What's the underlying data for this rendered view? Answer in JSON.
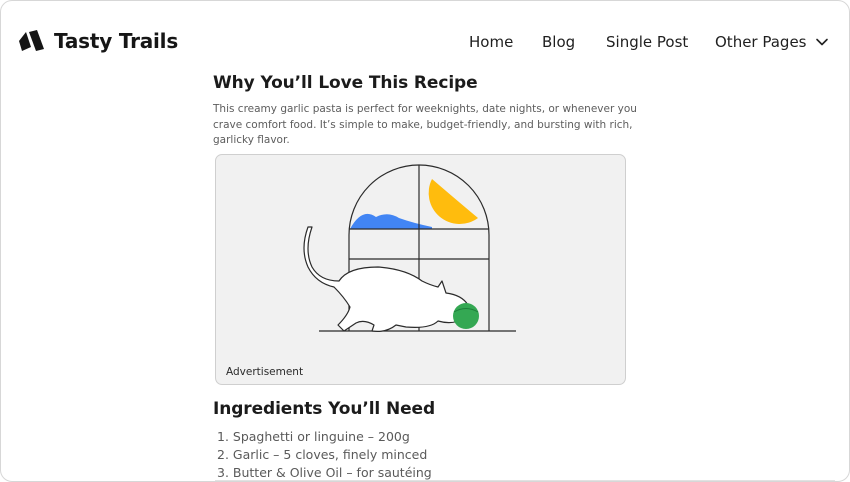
{
  "brand": {
    "name": "Tasty Trails",
    "logo_icon": "logo-icon"
  },
  "nav": {
    "items": [
      {
        "label": "Home"
      },
      {
        "label": "Blog"
      },
      {
        "label": "Single Post"
      },
      {
        "label": "Other Pages"
      }
    ],
    "dropdown_icon": "chevron-down-icon"
  },
  "article": {
    "section_love": {
      "heading": "Why You’ll Love This Recipe",
      "body": "This creamy garlic pasta is perfect for weeknights, date nights, or whenever you crave comfort food. It’s simple to make, budget-friendly, and bursting with rich, garlicky flavor."
    },
    "advertisement": {
      "label": "Advertisement",
      "illustration": "cat-playing-with-ball-by-window",
      "colors": {
        "sun": "#FFBC0D",
        "cloud": "#4285F4",
        "ball": "#34A853"
      }
    },
    "section_ingredients": {
      "heading": "Ingredients You’ll Need",
      "items": [
        "1. Spaghetti or linguine – 200g",
        "2. Garlic – 5 cloves, finely minced",
        "3. Butter & Olive Oil – for sautéing"
      ]
    }
  }
}
